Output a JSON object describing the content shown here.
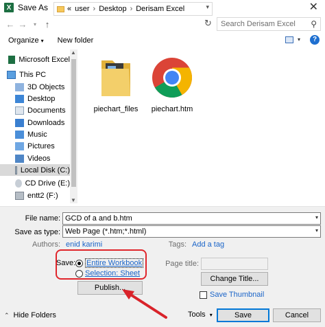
{
  "window": {
    "title": "Save As",
    "app_icon_letter": "X",
    "close": "✕"
  },
  "address": {
    "crumbs": [
      "«",
      "user",
      "Desktop",
      "Derisam Excel"
    ],
    "separator": "›",
    "search_placeholder": "Search Derisam Excel"
  },
  "toolbar": {
    "organize": "Organize",
    "new_folder": "New folder",
    "help": "?"
  },
  "nav": {
    "items": [
      {
        "label": "Microsoft Excel",
        "icon": "excel-icon"
      },
      {
        "label": "This PC",
        "icon": "pc-icon"
      },
      {
        "label": "3D Objects",
        "icon": "3d-objects-icon"
      },
      {
        "label": "Desktop",
        "icon": "desktop-icon"
      },
      {
        "label": "Documents",
        "icon": "documents-icon"
      },
      {
        "label": "Downloads",
        "icon": "downloads-icon"
      },
      {
        "label": "Music",
        "icon": "music-icon"
      },
      {
        "label": "Pictures",
        "icon": "pictures-icon"
      },
      {
        "label": "Videos",
        "icon": "videos-icon"
      },
      {
        "label": "Local Disk (C:)",
        "icon": "drive-icon"
      },
      {
        "label": "CD Drive (E:)",
        "icon": "cd-drive-icon"
      },
      {
        "label": "entt2 (F:)",
        "icon": "drive-icon"
      }
    ]
  },
  "files": [
    {
      "name": "piechart_files",
      "icon": "folder-icon"
    },
    {
      "name": "piechart.htm",
      "icon": "chrome-icon"
    }
  ],
  "form": {
    "file_name_label": "File name:",
    "file_name_value": "GCD of a and b.htm",
    "save_type_label": "Save as type:",
    "save_type_value": "Web Page (*.htm;*.html)",
    "authors_label": "Authors:",
    "authors_value": "enid karimi",
    "tags_label": "Tags:",
    "tags_value": "Add a tag",
    "save_label": "Save:",
    "entire_workbook": "Entire Workbook",
    "selection_sheet": "Selection: Sheet",
    "publish": "Publish...",
    "page_title_label": "Page title:",
    "change_title": "Change Title...",
    "save_thumbnail": "Save Thumbnail",
    "tools": "Tools",
    "save_btn": "Save",
    "cancel_btn": "Cancel",
    "hide_folders": "Hide Folders"
  },
  "colors": {
    "excel_green": "#1d6f42",
    "link_blue": "#1a64c8",
    "callout_red": "#e0252b",
    "arrow_red": "#d9232a"
  }
}
